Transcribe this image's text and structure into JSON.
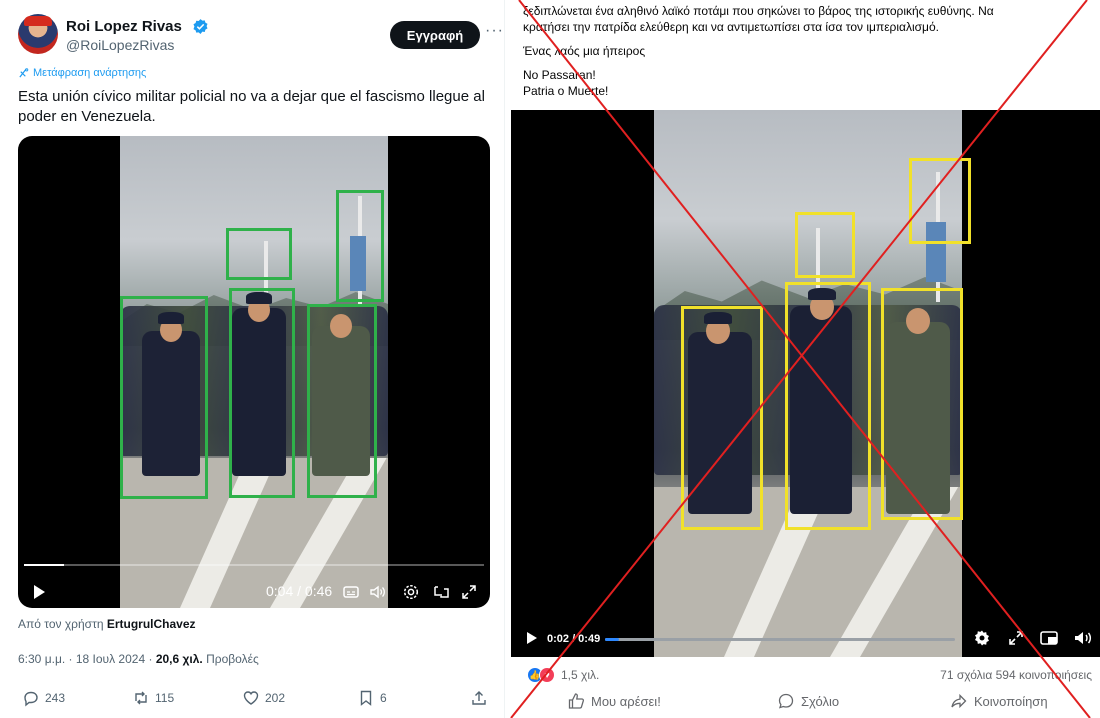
{
  "twitter": {
    "user_name": "Roi Lopez Rivas",
    "handle": "@RoiLopezRivas",
    "subscribe_label": "Εγγραφή",
    "more_label": "···",
    "translate_label": "Μετάφραση ανάρτησης",
    "post_text": "Esta unión cívico militar policial no va a dejar que el fascismo llegue al poder en Venezuela.",
    "video": {
      "time": "0:04 / 0:46",
      "progress": 0.087
    },
    "from_user_prefix": "Από τον χρήστη",
    "from_user_name": "ErtugrulChavez",
    "time_date": "6:30 μ.μ. · 18 Ιουλ 2024 ·",
    "views_count": "20,6 χιλ.",
    "views_label": "Προβολές",
    "stats": {
      "replies": "243",
      "reposts": "115",
      "likes": "202",
      "bookmarks": "6"
    },
    "icons": [
      "verified-badge-icon",
      "translate-icon",
      "play-icon",
      "captions-icon",
      "volume-icon",
      "settings-icon",
      "pip-icon",
      "fullscreen-icon",
      "reply-icon",
      "repost-icon",
      "like-icon",
      "bookmark-icon",
      "share-icon"
    ]
  },
  "facebook": {
    "post_line1": "ξεδιπλώνεται ένα αληθινό λαϊκό ποτάμι που σηκώνει το βάρος της ιστορικής ευθύνης. Να",
    "post_line2": "κρατήσει την πατρίδα ελεύθερη και να αντιμετωπίσει στα ίσα τον ιμπεριαλισμό.",
    "post_line3": "Ένας λαός μια ήπειρος",
    "post_line4": "No Passaran!",
    "post_line5": "Patria o Muerte!",
    "video": {
      "time": "0:02 / 0:49",
      "progress": 0.041
    },
    "reactions_count": "1,5 χιλ.",
    "comments_shares": "71 σχόλια  594 κοινοποιήσεις",
    "actions": {
      "like": "Μου αρέσει!",
      "comment": "Σχόλιο",
      "share": "Κοινοποίηση"
    },
    "icons": [
      "like-reaction-icon",
      "love-reaction-icon",
      "play-icon",
      "settings-icon",
      "fullscreen-icon",
      "pip-icon",
      "volume-icon",
      "thumbs-up-icon",
      "comment-icon",
      "share-icon"
    ]
  },
  "colors": {
    "green_box": "#2fb14a",
    "yellow_box": "#f1e12a",
    "cross": "#e02020",
    "twitter_blue": "#1d9bf0",
    "facebook_blue": "#1877f2"
  }
}
